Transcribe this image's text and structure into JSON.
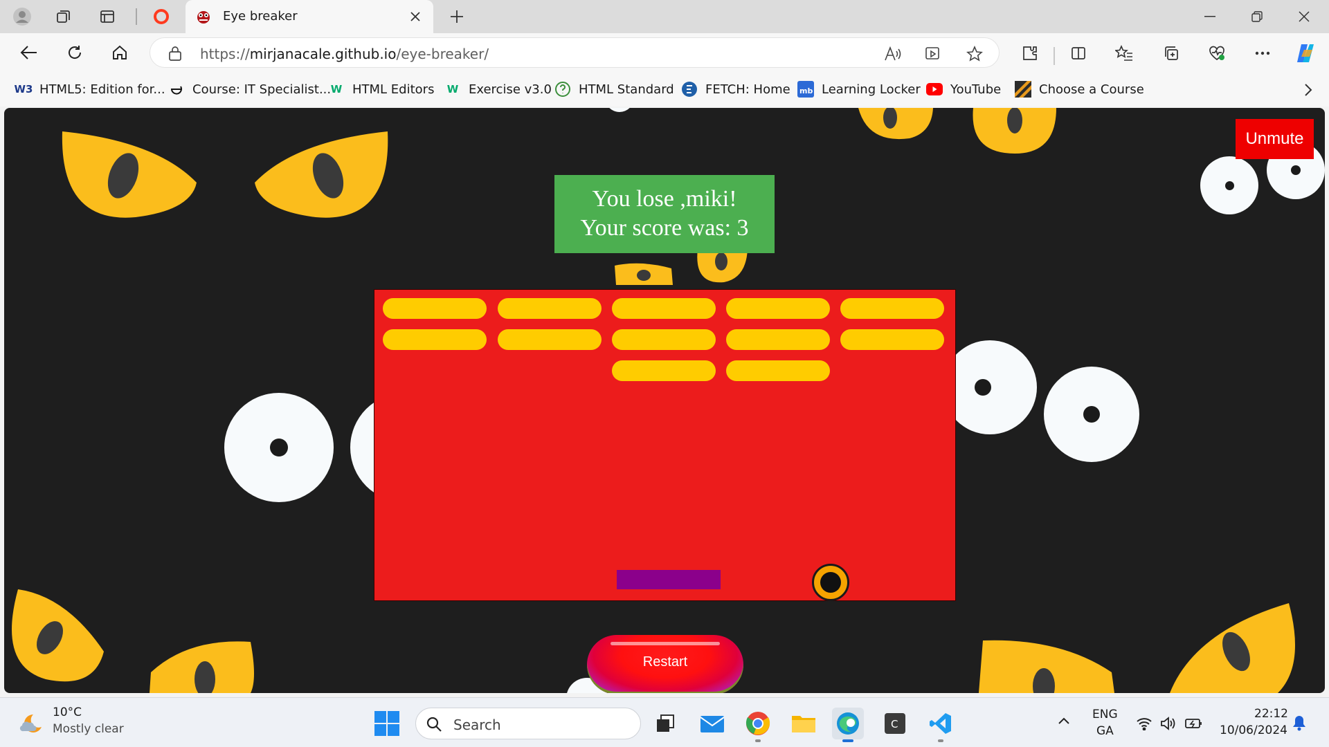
{
  "browser": {
    "tab": {
      "title": "Eye breaker"
    },
    "address": {
      "scheme": "https://",
      "host": "mirjanacale.github.io",
      "path": "/eye-breaker/"
    },
    "bookmarks": [
      {
        "label": "HTML5: Edition for...",
        "icon": "w3schools-icon"
      },
      {
        "label": "Course: IT Specialist...",
        "icon": "edge-e-icon"
      },
      {
        "label": "HTML Editors",
        "icon": "w3-green-icon"
      },
      {
        "label": "Exercise v3.0",
        "icon": "w3-green-icon"
      },
      {
        "label": "HTML Standard",
        "icon": "question-circle-icon"
      },
      {
        "label": "FETCH: Home",
        "icon": "fetch-icon"
      },
      {
        "label": "Learning Locker",
        "icon": "mb-icon"
      },
      {
        "label": "YouTube",
        "icon": "youtube-icon"
      },
      {
        "label": "Choose a Course",
        "icon": "stripes-icon"
      }
    ]
  },
  "game": {
    "unmute_label": "Unmute",
    "message_line1": "You lose ,miki!",
    "message_line2": "Your score was: 3",
    "restart_label": "Restart",
    "bricks_remaining": 12,
    "colors": {
      "background": "#1e1e1e",
      "canvas": "#ec1c1c",
      "brick": "#ffcc00",
      "paddle": "#8b008b",
      "ball": "#f5a300",
      "message": "#4caf50",
      "unmute": "#ee0000"
    }
  },
  "taskbar": {
    "weather_temp": "10°C",
    "weather_desc": "Mostly clear",
    "search_placeholder": "Search",
    "lang_line1": "ENG",
    "lang_line2": "GA",
    "time": "22:12",
    "date": "10/06/2024"
  }
}
